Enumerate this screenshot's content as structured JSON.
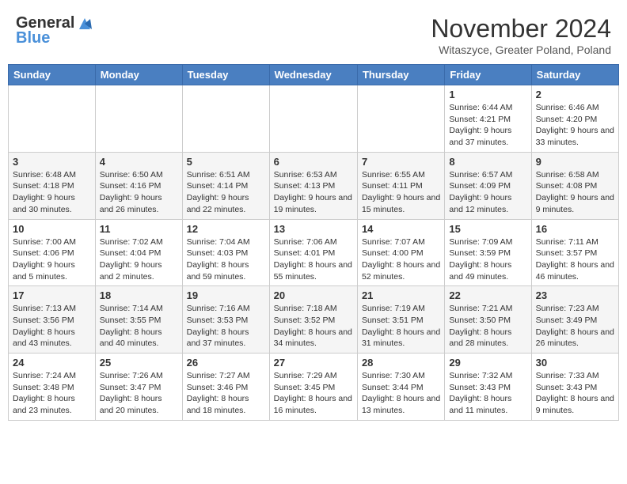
{
  "header": {
    "logo_general": "General",
    "logo_blue": "Blue",
    "month_title": "November 2024",
    "subtitle": "Witaszyce, Greater Poland, Poland"
  },
  "weekdays": [
    "Sunday",
    "Monday",
    "Tuesday",
    "Wednesday",
    "Thursday",
    "Friday",
    "Saturday"
  ],
  "weeks": [
    [
      {
        "day": "",
        "info": ""
      },
      {
        "day": "",
        "info": ""
      },
      {
        "day": "",
        "info": ""
      },
      {
        "day": "",
        "info": ""
      },
      {
        "day": "",
        "info": ""
      },
      {
        "day": "1",
        "info": "Sunrise: 6:44 AM\nSunset: 4:21 PM\nDaylight: 9 hours and 37 minutes."
      },
      {
        "day": "2",
        "info": "Sunrise: 6:46 AM\nSunset: 4:20 PM\nDaylight: 9 hours and 33 minutes."
      }
    ],
    [
      {
        "day": "3",
        "info": "Sunrise: 6:48 AM\nSunset: 4:18 PM\nDaylight: 9 hours and 30 minutes."
      },
      {
        "day": "4",
        "info": "Sunrise: 6:50 AM\nSunset: 4:16 PM\nDaylight: 9 hours and 26 minutes."
      },
      {
        "day": "5",
        "info": "Sunrise: 6:51 AM\nSunset: 4:14 PM\nDaylight: 9 hours and 22 minutes."
      },
      {
        "day": "6",
        "info": "Sunrise: 6:53 AM\nSunset: 4:13 PM\nDaylight: 9 hours and 19 minutes."
      },
      {
        "day": "7",
        "info": "Sunrise: 6:55 AM\nSunset: 4:11 PM\nDaylight: 9 hours and 15 minutes."
      },
      {
        "day": "8",
        "info": "Sunrise: 6:57 AM\nSunset: 4:09 PM\nDaylight: 9 hours and 12 minutes."
      },
      {
        "day": "9",
        "info": "Sunrise: 6:58 AM\nSunset: 4:08 PM\nDaylight: 9 hours and 9 minutes."
      }
    ],
    [
      {
        "day": "10",
        "info": "Sunrise: 7:00 AM\nSunset: 4:06 PM\nDaylight: 9 hours and 5 minutes."
      },
      {
        "day": "11",
        "info": "Sunrise: 7:02 AM\nSunset: 4:04 PM\nDaylight: 9 hours and 2 minutes."
      },
      {
        "day": "12",
        "info": "Sunrise: 7:04 AM\nSunset: 4:03 PM\nDaylight: 8 hours and 59 minutes."
      },
      {
        "day": "13",
        "info": "Sunrise: 7:06 AM\nSunset: 4:01 PM\nDaylight: 8 hours and 55 minutes."
      },
      {
        "day": "14",
        "info": "Sunrise: 7:07 AM\nSunset: 4:00 PM\nDaylight: 8 hours and 52 minutes."
      },
      {
        "day": "15",
        "info": "Sunrise: 7:09 AM\nSunset: 3:59 PM\nDaylight: 8 hours and 49 minutes."
      },
      {
        "day": "16",
        "info": "Sunrise: 7:11 AM\nSunset: 3:57 PM\nDaylight: 8 hours and 46 minutes."
      }
    ],
    [
      {
        "day": "17",
        "info": "Sunrise: 7:13 AM\nSunset: 3:56 PM\nDaylight: 8 hours and 43 minutes."
      },
      {
        "day": "18",
        "info": "Sunrise: 7:14 AM\nSunset: 3:55 PM\nDaylight: 8 hours and 40 minutes."
      },
      {
        "day": "19",
        "info": "Sunrise: 7:16 AM\nSunset: 3:53 PM\nDaylight: 8 hours and 37 minutes."
      },
      {
        "day": "20",
        "info": "Sunrise: 7:18 AM\nSunset: 3:52 PM\nDaylight: 8 hours and 34 minutes."
      },
      {
        "day": "21",
        "info": "Sunrise: 7:19 AM\nSunset: 3:51 PM\nDaylight: 8 hours and 31 minutes."
      },
      {
        "day": "22",
        "info": "Sunrise: 7:21 AM\nSunset: 3:50 PM\nDaylight: 8 hours and 28 minutes."
      },
      {
        "day": "23",
        "info": "Sunrise: 7:23 AM\nSunset: 3:49 PM\nDaylight: 8 hours and 26 minutes."
      }
    ],
    [
      {
        "day": "24",
        "info": "Sunrise: 7:24 AM\nSunset: 3:48 PM\nDaylight: 8 hours and 23 minutes."
      },
      {
        "day": "25",
        "info": "Sunrise: 7:26 AM\nSunset: 3:47 PM\nDaylight: 8 hours and 20 minutes."
      },
      {
        "day": "26",
        "info": "Sunrise: 7:27 AM\nSunset: 3:46 PM\nDaylight: 8 hours and 18 minutes."
      },
      {
        "day": "27",
        "info": "Sunrise: 7:29 AM\nSunset: 3:45 PM\nDaylight: 8 hours and 16 minutes."
      },
      {
        "day": "28",
        "info": "Sunrise: 7:30 AM\nSunset: 3:44 PM\nDaylight: 8 hours and 13 minutes."
      },
      {
        "day": "29",
        "info": "Sunrise: 7:32 AM\nSunset: 3:43 PM\nDaylight: 8 hours and 11 minutes."
      },
      {
        "day": "30",
        "info": "Sunrise: 7:33 AM\nSunset: 3:43 PM\nDaylight: 8 hours and 9 minutes."
      }
    ]
  ]
}
